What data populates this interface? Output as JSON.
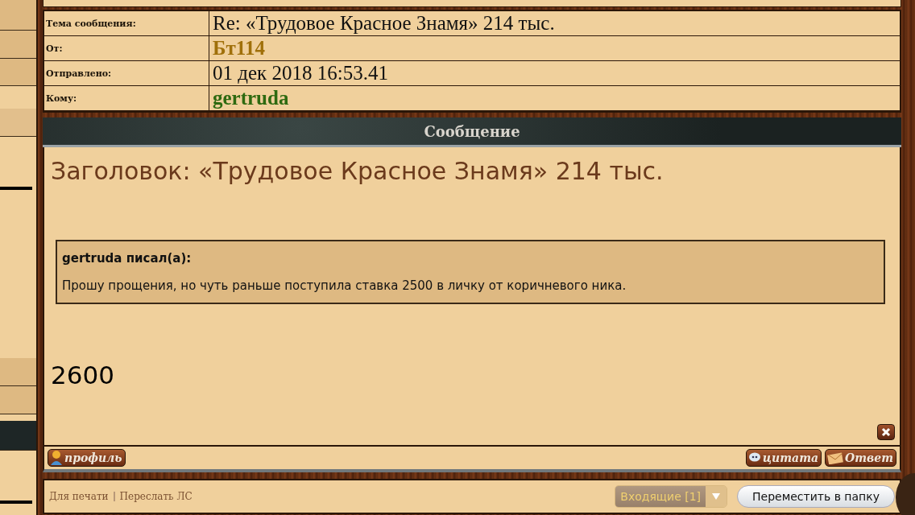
{
  "header_fields": [
    {
      "label": "Тема сообщения:",
      "value": "Re: «Трудовое Красное Знамя» 214 тыс.",
      "kind": "plain"
    },
    {
      "label": "От:",
      "value": "Бт114",
      "kind": "sender"
    },
    {
      "label": "Отправлено:",
      "value": "01 дек 2018 16:53.41",
      "kind": "plain"
    },
    {
      "label": "Кому:",
      "value": "gertruda",
      "kind": "recipient"
    }
  ],
  "section_title": "Сообщение",
  "message": {
    "subject": "Заголовок: «Трудовое Красное Знамя» 214 тыс.",
    "quote": {
      "author": "gertruda писал(а):",
      "text": "Прошу прощения, но чуть раньше поступила ставка 2500 в личку от коричневого ника."
    },
    "body": "2600"
  },
  "left_actions": [
    {
      "label": "профиль",
      "kind": "profile"
    }
  ],
  "right_actions": [
    {
      "label": "цитата",
      "kind": "quote"
    },
    {
      "label": "Ответ",
      "kind": "reply"
    }
  ],
  "footer": {
    "links": [
      "Для печати",
      "Переслать ЛС"
    ],
    "folder_select": "Входящие [1]",
    "move_button": "Переместить в папку"
  }
}
